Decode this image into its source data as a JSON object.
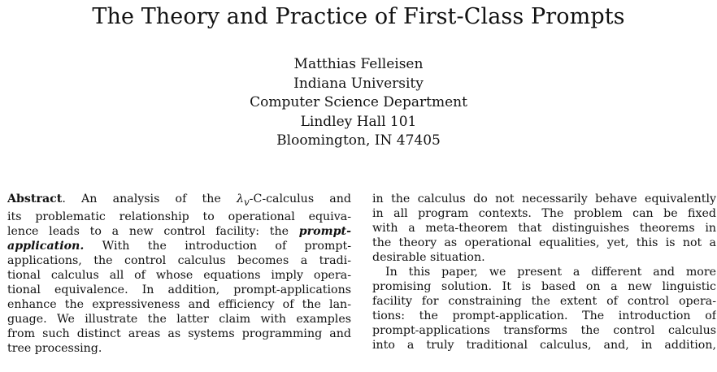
{
  "paper": {
    "title": "The Theory and Practice of First-Class Prompts",
    "author_lines": [
      "Matthias Felleisen",
      "Indiana University",
      "Computer Science Department",
      "Lindley Hall 101",
      "Bloomington, IN 47405"
    ],
    "left_column": {
      "abstract_label": "Abstract",
      "line_1_after_label": ". An analysis of the ",
      "lambda_symbol": "λ",
      "lambda_subscript": "v",
      "line_1_end": "-C-calculus and",
      "line_2": "its problematic relationship to operational equiva-",
      "line_3_start": "lence leads to a new control facility: the ",
      "term_1": "prompt-",
      "term_2": "application.",
      "line_4_end": "   With the introduction of prompt-",
      "line_5": "applications, the control calculus becomes a tradi-",
      "line_6": "tional calculus all of whose equations imply opera-",
      "line_7": "tional equivalence. In addition, prompt-applications",
      "line_8": "enhance the expressiveness and efficiency of the lan-",
      "line_9": "guage. We illustrate the latter claim with examples",
      "line_10": "from such distinct areas as systems programming and",
      "line_11": "tree processing."
    },
    "right_column": {
      "lines": [
        "in the calculus do not necessarily behave equivalently",
        "in all program contexts. The problem can be fixed",
        "with a meta-theorem that distinguishes theorems in",
        "the theory as operational equalities, yet, this is not a",
        "desirable situation.",
        "In this paper, we present a different and more",
        "promising solution. It is based on a new linguistic",
        "facility for constraining the extent of control opera-",
        "tions: the prompt-application. The introduction of",
        "prompt-applications transforms the control calculus",
        "into a truly traditional calculus, and, in addition,"
      ]
    }
  }
}
